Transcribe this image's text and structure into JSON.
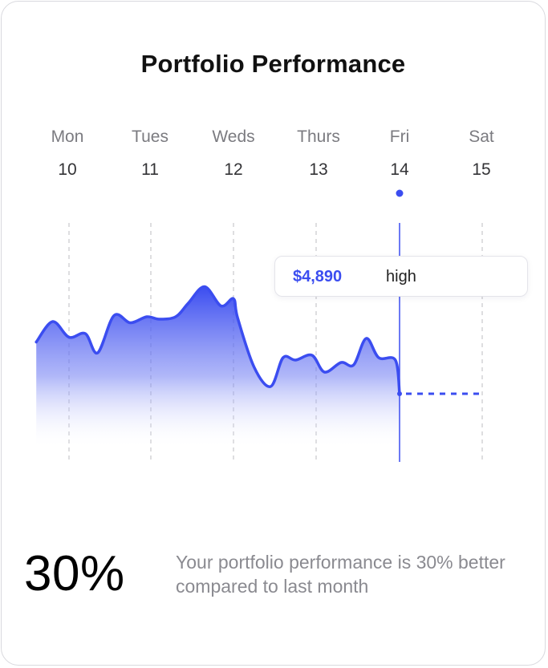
{
  "card": {
    "title": "Portfolio Performance",
    "days": [
      {
        "day": "Mon",
        "date": "10"
      },
      {
        "day": "Tues",
        "date": "11"
      },
      {
        "day": "Weds",
        "date": "12"
      },
      {
        "day": "Thurs",
        "date": "13"
      },
      {
        "day": "Fri",
        "date": "14"
      },
      {
        "day": "Sat",
        "date": "15"
      }
    ],
    "tooltip": {
      "value": "$4,890",
      "label": "high"
    },
    "stat": {
      "value": "30%",
      "description": "Your portfolio performance is 30% better compared to last month"
    }
  },
  "colors": {
    "accent": "#3b4df0",
    "gridline": "#bdbdc2",
    "text_muted": "#8a8a90"
  },
  "chart_data": {
    "type": "area",
    "categories": [
      "Mon 10",
      "Tues 11",
      "Weds 12",
      "Thurs 13",
      "Fri 14",
      "Sat 15"
    ],
    "selected_category": "Fri 14",
    "x": [
      9.6,
      9.8,
      10.0,
      10.2,
      10.35,
      10.55,
      10.75,
      10.95,
      11.1,
      11.3,
      11.45,
      11.65,
      11.85,
      12.0,
      12.05,
      12.25,
      12.45,
      12.6,
      12.75,
      12.95,
      13.1,
      13.3,
      13.45,
      13.6,
      13.75,
      13.95,
      14.0
    ],
    "values": [
      43,
      60,
      47,
      50,
      34,
      65,
      59,
      64,
      62,
      64,
      75,
      89,
      73,
      79,
      63,
      22,
      6,
      30,
      28,
      32,
      18,
      26,
      24,
      46,
      30,
      28,
      0
    ],
    "projection": {
      "x": [
        14.0,
        15.0
      ],
      "values": [
        0,
        0
      ],
      "style": "dashed"
    },
    "grid": "vertical-dashed",
    "legend": "none"
  }
}
